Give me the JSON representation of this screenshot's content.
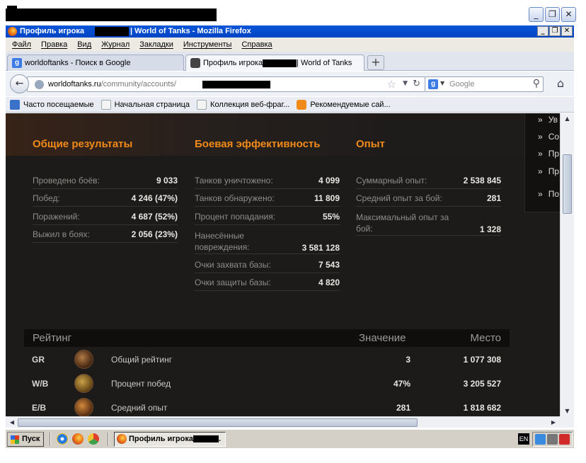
{
  "window": {
    "title": "Профиль игрока",
    "title_suffix": "| World of Tanks - Mozilla Firefox"
  },
  "menu": [
    "Файл",
    "Правка",
    "Вид",
    "Журнал",
    "Закладки",
    "Инструменты",
    "Справка"
  ],
  "tabs": [
    {
      "label": "worldoftanks - Поиск в Google",
      "icon": "google-icon",
      "active": false
    },
    {
      "label_prefix": "Профиль игрока",
      "label_suffix": "| World of Tanks",
      "icon": "wot-icon",
      "active": true
    }
  ],
  "navbar": {
    "url_host": "worldoftanks.ru",
    "url_path": "/community/accounts/",
    "search_placeholder": "Google"
  },
  "bookmarks": [
    {
      "label": "Часто посещаемые",
      "icon": "most-visited-icon"
    },
    {
      "label": "Начальная страница",
      "icon": "page-icon"
    },
    {
      "label": "Коллекция веб-фраг...",
      "icon": "page-icon"
    },
    {
      "label": "Рекомендуемые сай...",
      "icon": "suggested-sites-icon"
    }
  ],
  "sidebar_items": [
    "Ув",
    "Со",
    "Пр",
    "Пр",
    "По"
  ],
  "general": {
    "title": "Общие результаты",
    "rows": [
      {
        "label": "Проведено боёв:",
        "value": "9 033"
      },
      {
        "label": "Побед:",
        "value": "4 246 (47%)"
      },
      {
        "label": "Поражений:",
        "value": "4 687 (52%)"
      },
      {
        "label": "Выжил в боях:",
        "value": "2 056 (23%)"
      }
    ]
  },
  "battle": {
    "title": "Боевая эффективность",
    "rows": [
      {
        "label": "Танков уничтожено:",
        "value": "4 099"
      },
      {
        "label": "Танков обнаружено:",
        "value": "11 809"
      },
      {
        "label": "Процент попадания:",
        "value": "55%"
      },
      {
        "label": "Нанесённые повреждения:",
        "value": "3 581 128"
      },
      {
        "label": "Очки захвата базы:",
        "value": "7 543"
      },
      {
        "label": "Очки защиты базы:",
        "value": "4 820"
      }
    ]
  },
  "experience": {
    "title": "Опыт",
    "rows": [
      {
        "label": "Суммарный опыт:",
        "value": "2 538 845"
      },
      {
        "label": "Средний опыт за бой:",
        "value": "281"
      },
      {
        "label": "Максимальный опыт за бой:",
        "value": "1 328"
      }
    ]
  },
  "rating": {
    "headers": {
      "name": "Рейтинг",
      "value": "Значение",
      "place": "Место"
    },
    "rows": [
      {
        "code": "GR",
        "name": "Общий рейтинг",
        "value": "3",
        "place": "1 077 308",
        "icon": "general-rating-medal-icon"
      },
      {
        "code": "W/B",
        "name": "Процент побед",
        "value": "47%",
        "place": "3 205 527",
        "icon": "scales-medal-icon"
      },
      {
        "code": "E/B",
        "name": "Средний опыт",
        "value": "281",
        "place": "1 818 682",
        "icon": "star-medal-icon"
      }
    ]
  },
  "taskbar": {
    "start": "Пуск",
    "task_label": "Профиль игрока",
    "lang": "EN"
  }
}
